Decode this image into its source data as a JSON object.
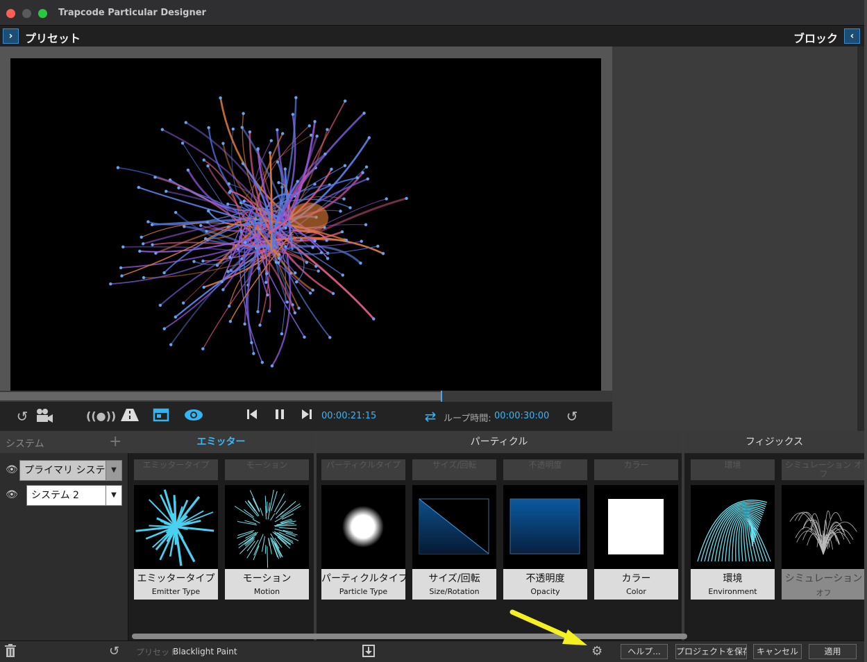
{
  "window": {
    "title": "Trapcode Particular Designer"
  },
  "topbar": {
    "left_label": "プリセット",
    "right_label": "ブロック",
    "left_btn": "›",
    "right_btn": "‹"
  },
  "playback": {
    "timecode": "00:00:21:15",
    "loop_label": "ループ時間:",
    "loop_time": "00:00:30:00",
    "progress": 0.72
  },
  "system_panel": {
    "title": "システム",
    "add_label": "+",
    "systems": [
      {
        "name": "プライマリ システム",
        "selected": true
      },
      {
        "name": "システム 2",
        "selected": false
      }
    ]
  },
  "categories": [
    {
      "label": "エミッター",
      "active": true
    },
    {
      "label": "パーティクル",
      "active": false
    },
    {
      "label": "フィジックス",
      "active": false
    }
  ],
  "slots": [
    "エミッタータイプ",
    "モーション",
    "パーティクルタイプ",
    "サイズ/回転",
    "不透明度",
    "カラー",
    "環境",
    "シミュレーション オフ"
  ],
  "cards": [
    {
      "ja": "エミッタータイプ",
      "en": "Emitter Type"
    },
    {
      "ja": "モーション",
      "en": "Motion"
    },
    {
      "ja": "パーティクルタイプ",
      "en": "Particle Type"
    },
    {
      "ja": "サイズ/回転",
      "en": "Size/Rotation"
    },
    {
      "ja": "不透明度",
      "en": "Opacity"
    },
    {
      "ja": "カラー",
      "en": "Color"
    },
    {
      "ja": "環境",
      "en": "Environment"
    },
    {
      "ja": "シミュレーション",
      "en": "オフ"
    }
  ],
  "statusbar": {
    "preset_label": "プリセット",
    "preset_value": "Blacklight Paint",
    "help_label": "ヘルプ...",
    "save_project_label": "プロジェクトを保存",
    "cancel_label": "キャンセル",
    "apply_label": "適用"
  },
  "colors": {
    "accent": "#33b5f2",
    "annotation_arrow": "#f5f020"
  },
  "icons": [
    "undo-icon",
    "camera-icon",
    "audio-icon",
    "ground-icon",
    "frame-icon",
    "eye-icon",
    "skip-back-icon",
    "pause-icon",
    "skip-forward-icon",
    "loop-icon",
    "reset-icon",
    "trash-icon",
    "download-icon",
    "gear-icon"
  ]
}
